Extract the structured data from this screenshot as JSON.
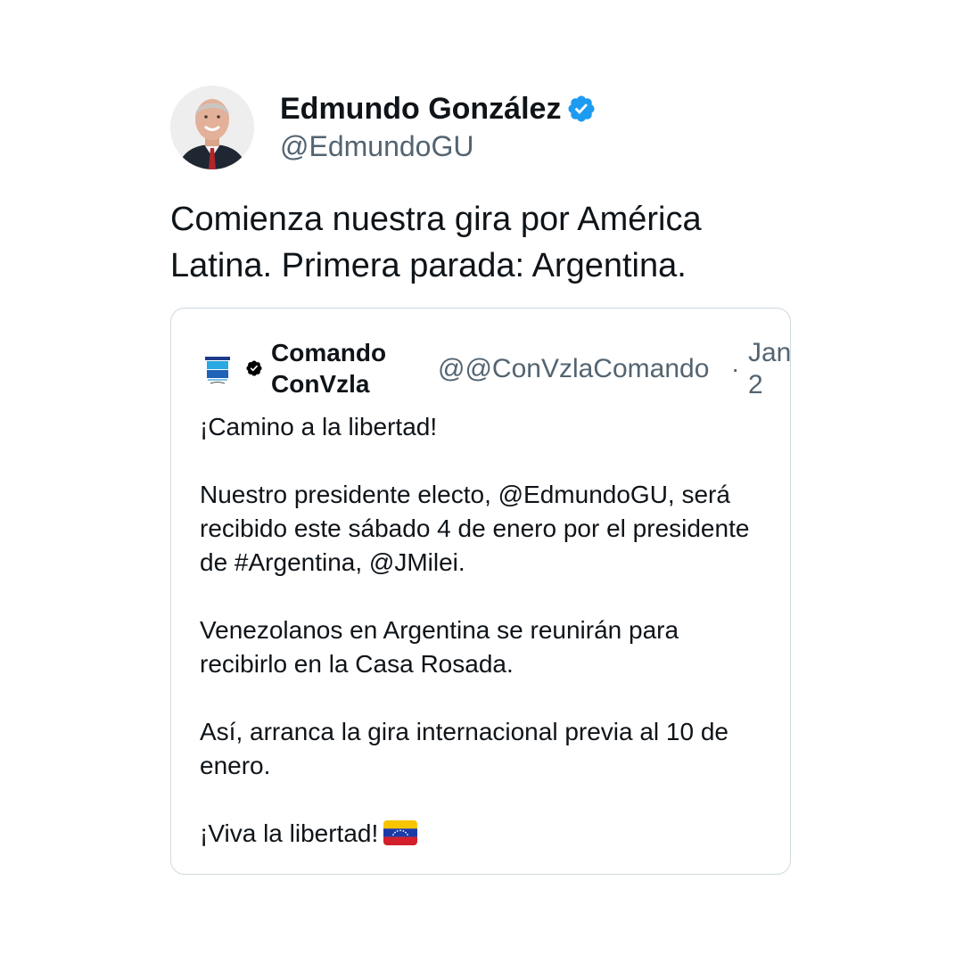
{
  "tweet": {
    "author": {
      "name": "Edmundo González",
      "handle": "@EdmundoGU",
      "verified_color": "#1d9bf0"
    },
    "text": "Comienza nuestra gira por América Latina. Primera parada: Argentina."
  },
  "quote": {
    "author": {
      "name": "Comando ConVzla",
      "handle": "@@ConVzlaComando",
      "logo_icon": "comando-convzla-logo",
      "verified_color": "#000000"
    },
    "separator": "·",
    "date": "Jan 2",
    "paragraphs": [
      "¡Camino a la libertad!",
      "Nuestro presidente electo, @EdmundoGU, será recibido este sábado 4 de enero por el presidente de #Argentina, @JMilei.",
      "Venezolanos en Argentina se reunirán para recibirlo en la Casa Rosada.",
      "Así, arranca la gira internacional previa al 10 de enero.",
      "¡Viva la libertad!"
    ],
    "emoji_icon": "venezuela-flag"
  },
  "colors": {
    "text_primary": "#0f1419",
    "text_secondary": "#536471",
    "border": "#cfd9de"
  }
}
